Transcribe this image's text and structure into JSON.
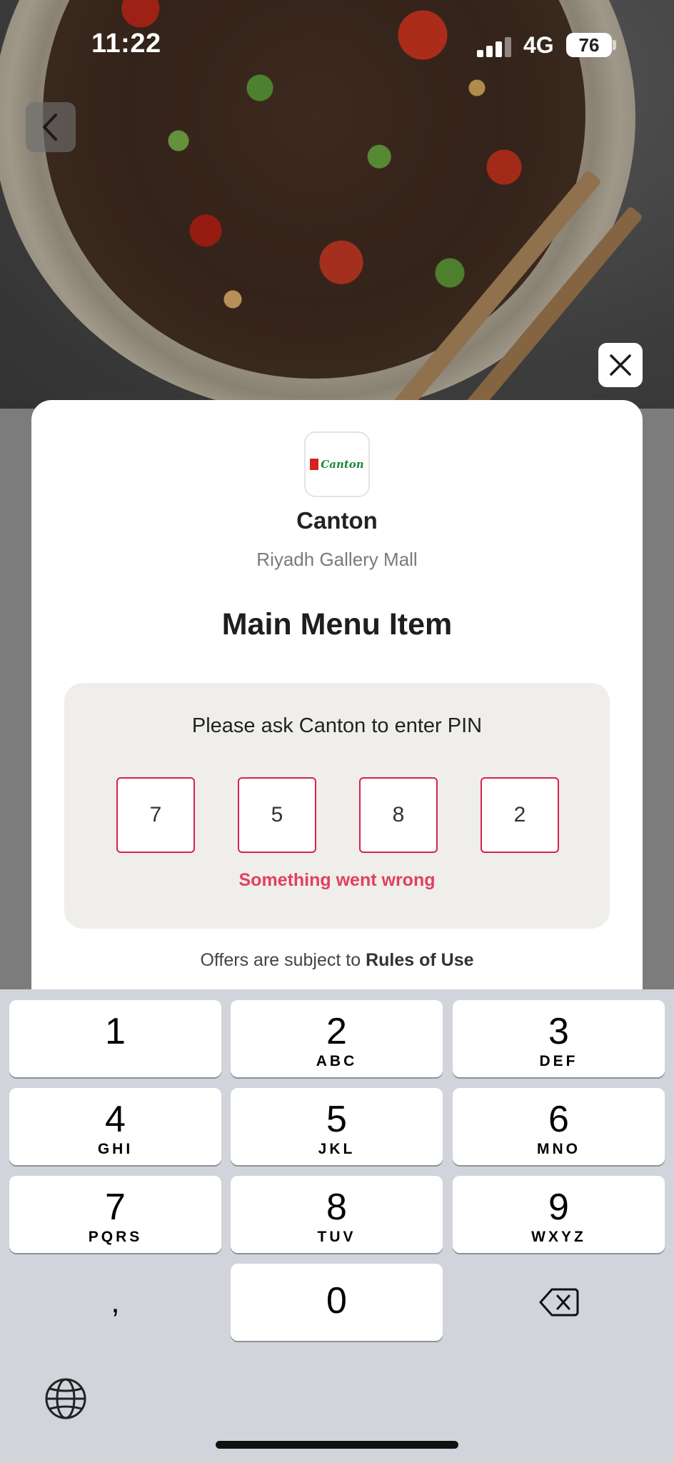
{
  "status_bar": {
    "time": "11:22",
    "network": "4G",
    "battery": "76"
  },
  "nav": {
    "back_icon": "chevron-left-icon",
    "close_icon": "close-icon"
  },
  "restaurant": {
    "logo_text": "Canton",
    "name": "Canton",
    "location": "Riyadh Gallery Mall"
  },
  "offer": {
    "title": "Main Menu Item"
  },
  "pin": {
    "prompt": "Please ask Canton to enter PIN",
    "digits": [
      "7",
      "5",
      "8",
      "2"
    ],
    "error": "Something went wrong",
    "error_color": "#e0415e",
    "border_color": "#d4244e"
  },
  "terms": {
    "prefix": "Offers are subject to ",
    "link": "Rules of Use"
  },
  "keypad": {
    "keys": [
      {
        "num": "1",
        "letters": ""
      },
      {
        "num": "2",
        "letters": "ABC"
      },
      {
        "num": "3",
        "letters": "DEF"
      },
      {
        "num": "4",
        "letters": "GHI"
      },
      {
        "num": "5",
        "letters": "JKL"
      },
      {
        "num": "6",
        "letters": "MNO"
      },
      {
        "num": "7",
        "letters": "PQRS"
      },
      {
        "num": "8",
        "letters": "TUV"
      },
      {
        "num": "9",
        "letters": "WXYZ"
      },
      {
        "num": "0",
        "letters": ""
      }
    ],
    "comma": ",",
    "delete_icon": "backspace-icon",
    "globe_icon": "globe-icon"
  }
}
